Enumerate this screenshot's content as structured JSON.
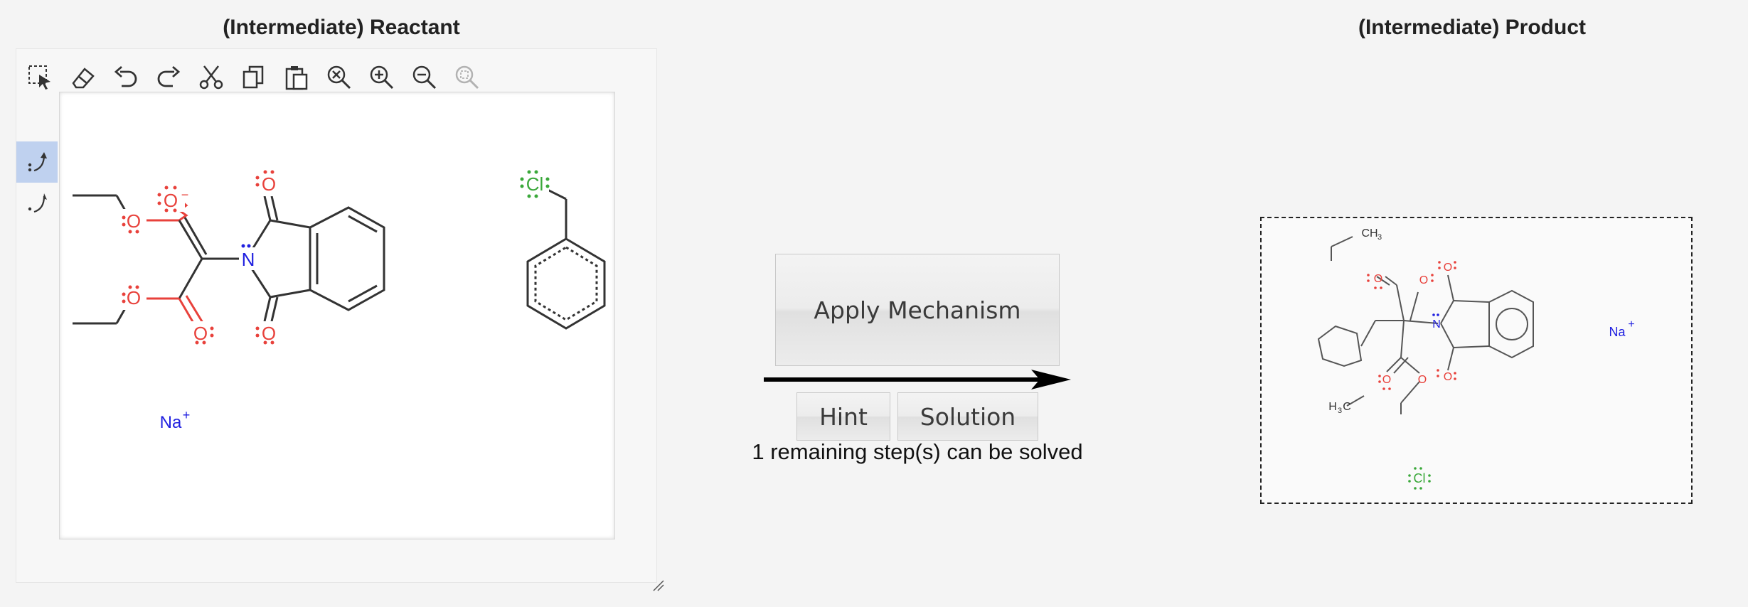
{
  "reactant": {
    "title": "(Intermediate) Reactant",
    "atoms": {
      "o_minus": "O",
      "minus": "−",
      "o": "O",
      "n": "N",
      "cl": "Cl",
      "na": "Na",
      "plus": "+"
    }
  },
  "toolbar": {
    "items": [
      {
        "icon": "select-icon"
      },
      {
        "icon": "eraser-icon"
      },
      {
        "icon": "undo-icon"
      },
      {
        "icon": "redo-icon"
      },
      {
        "icon": "cut-icon"
      },
      {
        "icon": "copy-icon"
      },
      {
        "icon": "paste-icon"
      },
      {
        "icon": "zoom-fit-icon"
      },
      {
        "icon": "zoom-in-icon"
      },
      {
        "icon": "zoom-out-icon"
      },
      {
        "icon": "zoom-reset-icon"
      }
    ],
    "side_items": [
      {
        "icon": "electron-pair-arrow-icon",
        "selected": true
      },
      {
        "icon": "single-electron-arrow-icon",
        "selected": false
      }
    ]
  },
  "actions": {
    "apply_label": "Apply Mechanism",
    "hint_label": "Hint",
    "solution_label": "Solution",
    "status_text": "1 remaining step(s) can be solved"
  },
  "product": {
    "title": "(Intermediate) Product",
    "atoms": {
      "ch3": "CH",
      "h3c_h": "H",
      "h3c_c": "C",
      "three": "3",
      "o": "O",
      "n": "N",
      "na": "Na",
      "plus": "+",
      "cl": "Cl"
    }
  },
  "colors": {
    "oxygen": "#e8413b",
    "nitrogen": "#2020e0",
    "chlorine": "#3aa83a",
    "sodium": "#2020e0",
    "bond": "#333333",
    "selected_tool": "#bfd1ef"
  }
}
